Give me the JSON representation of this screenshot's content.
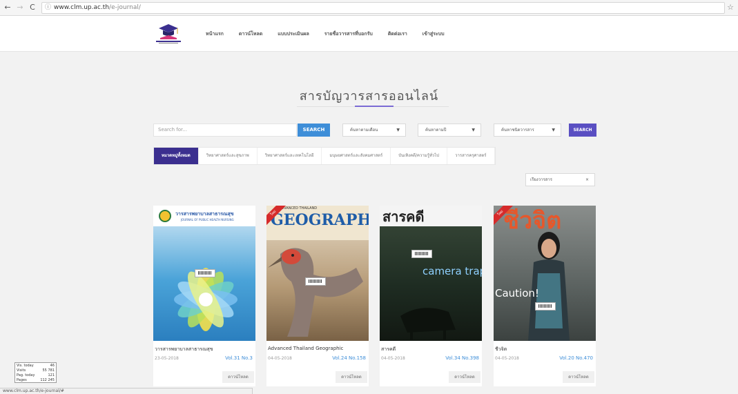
{
  "browser": {
    "url_host": "www.clm.up.ac.th",
    "url_path": "/e-journal/"
  },
  "nav": {
    "items": [
      "หน้าแรก",
      "ดาวน์โหลด",
      "แบบประเมินผล",
      "รายชื่อวารสารที่บอกรับ",
      "ติดต่อเรา",
      "เข้าสู่ระบบ"
    ]
  },
  "page": {
    "title": "สารบัญวารสารออนไลน์"
  },
  "search": {
    "placeholder": "Search for...",
    "button": "SEARCH",
    "month_select": "ค้นหาตามเดือน",
    "year_select": "ค้นหาตามปี",
    "type_select": "ค้นหาชนิดวารสาร",
    "button2": "SEARCH"
  },
  "categories": [
    "หมวดหมู่ทั้งหมด",
    "วิทยาศาสตร์และสุขภาพ",
    "วิทยาศาสตร์และเทคโนโลยี",
    "มนุษยศาสตร์และสังคมศาสตร์",
    "บันเทิงคดี/ความรู้ทั่วไป",
    "วารสารครุศาสตร์"
  ],
  "sort": {
    "label": "เรียงวารสาร"
  },
  "journals": [
    {
      "title": "วารสารพยาบาลสาธารณสุข",
      "date": "23-05-2018",
      "volume": "Vol.31 No.3",
      "download": "ดาวน์โหลด",
      "cover_text": "วารสารพยาบาลสาธารณสุข",
      "cover_sub": "JOURNAL OF PUBLIC HEALTH NURSING"
    },
    {
      "title": "Advanced Thailand Geographic",
      "date": "04-05-2018",
      "volume": "Vol.24 No.158",
      "download": "ดาวน์โหลด",
      "cover_text": "GEOGRAPHIC",
      "cover_sub": "ADVANCED THAILAND"
    },
    {
      "title": "สารคดี",
      "date": "04-05-2018",
      "volume": "Vol.34 No.398",
      "download": "ดาวน์โหลด",
      "cover_text": "สารคดี",
      "cover_sub": "camera trap"
    },
    {
      "title": "ชีวจิต",
      "date": "04-05-2018",
      "volume": "Vol.20 No.470",
      "download": "ดาวน์โหลด",
      "cover_text": "ชีวจิต",
      "cover_sub": "Caution!"
    }
  ],
  "stats": [
    {
      "label": "Vis. today",
      "value": "46"
    },
    {
      "label": "Visits",
      "value": "55 781"
    },
    {
      "label": "Pag. today",
      "value": "121"
    },
    {
      "label": "Pages",
      "value": "112 245"
    }
  ],
  "statusbar": "www.clm.up.ac.th/e-journal/#",
  "colors": {
    "accent_blue": "#3e8ed8",
    "accent_purple": "#3b2f8f",
    "title_underline": "#7a6ad4"
  }
}
